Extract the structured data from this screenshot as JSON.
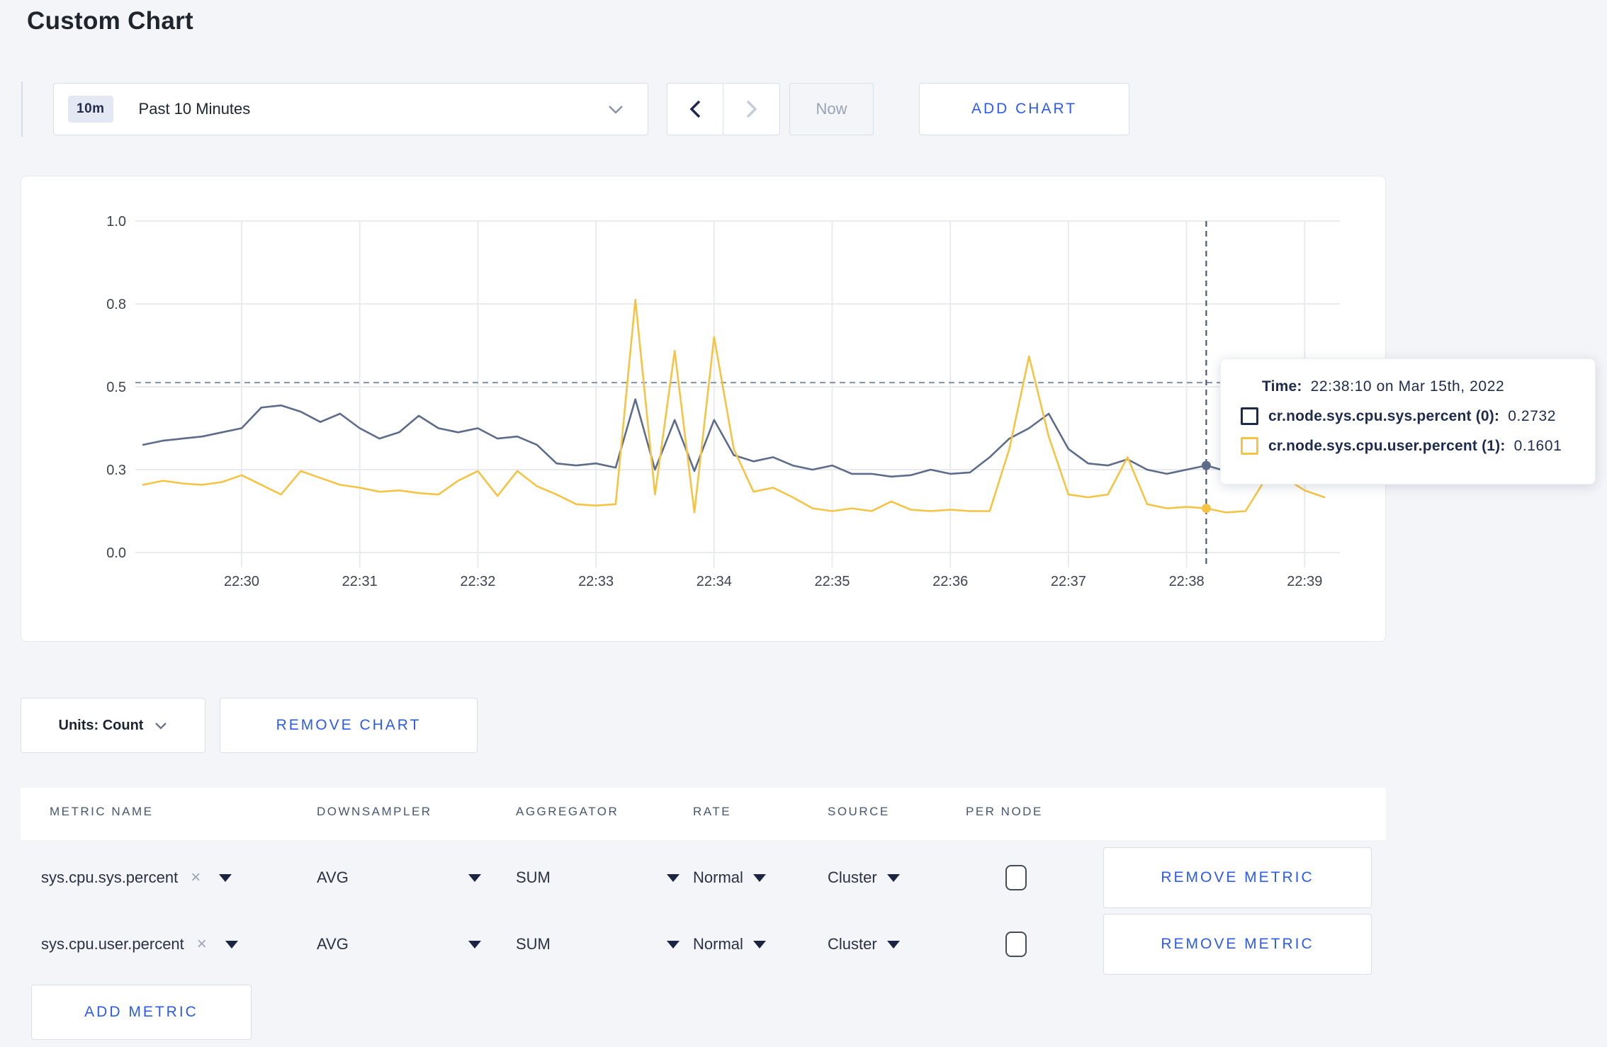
{
  "page": {
    "title": "Custom Chart"
  },
  "toolbar": {
    "range_badge": "10m",
    "range_label": "Past 10 Minutes",
    "now_label": "Now",
    "add_chart_label": "ADD CHART"
  },
  "chart_data": {
    "type": "line",
    "title": "",
    "xlabel": "",
    "ylabel": "",
    "y_ticks": [
      0.0,
      0.3,
      0.5,
      0.8,
      1.0
    ],
    "y_tick_labels": [
      "0.0",
      "0.3",
      "0.5",
      "0.8",
      "1.0"
    ],
    "y_scale_note": "ticks rendered equally spaced",
    "x_ticks": [
      "22:30",
      "22:31",
      "22:32",
      "22:33",
      "22:34",
      "22:35",
      "22:36",
      "22:37",
      "22:38",
      "22:39"
    ],
    "x_start_offset_sec": -50,
    "interval_sec": 10,
    "grid": true,
    "legend_position": "tooltip",
    "series": [
      {
        "name": "cr.node.sys.cpu.sys.percent (0)",
        "color": "#5d6c8b",
        "values": [
          0.36,
          0.37,
          0.375,
          0.38,
          0.39,
          0.4,
          0.45,
          0.455,
          0.44,
          0.415,
          0.435,
          0.4,
          0.375,
          0.39,
          0.43,
          0.4,
          0.39,
          0.4,
          0.375,
          0.38,
          0.36,
          0.315,
          0.31,
          0.315,
          0.305,
          0.47,
          0.3,
          0.42,
          0.295,
          0.42,
          0.335,
          0.32,
          0.33,
          0.31,
          0.3,
          0.31,
          0.285,
          0.285,
          0.275,
          0.28,
          0.3,
          0.285,
          0.29,
          0.33,
          0.375,
          0.4,
          0.435,
          0.35,
          0.315,
          0.31,
          0.325,
          0.3,
          0.285,
          0.3,
          0.31,
          0.295,
          0.3,
          0.31,
          0.3,
          0.305,
          0.3
        ]
      },
      {
        "name": "cr.node.sys.cpu.user.percent (1)",
        "color": "#f6c444",
        "values": [
          0.245,
          0.26,
          0.25,
          0.245,
          0.255,
          0.28,
          0.245,
          0.21,
          0.295,
          0.27,
          0.245,
          0.235,
          0.22,
          0.225,
          0.215,
          0.21,
          0.26,
          0.295,
          0.205,
          0.295,
          0.24,
          0.21,
          0.175,
          0.17,
          0.175,
          0.81,
          0.21,
          0.63,
          0.145,
          0.68,
          0.35,
          0.22,
          0.235,
          0.2,
          0.16,
          0.15,
          0.16,
          0.15,
          0.185,
          0.155,
          0.15,
          0.155,
          0.15,
          0.15,
          0.35,
          0.61,
          0.38,
          0.21,
          0.2,
          0.21,
          0.33,
          0.175,
          0.16,
          0.165,
          0.16,
          0.145,
          0.15,
          0.265,
          0.27,
          0.225,
          0.2
        ]
      }
    ],
    "crosshair": {
      "x_offset_sec": 490,
      "y_value": 0.515,
      "points": [
        {
          "series": 0,
          "value": 0.31
        },
        {
          "series": 1,
          "value": 0.16
        }
      ]
    },
    "colors": {
      "grid": "#e9ebee",
      "crosshair_h": "#7e93ab",
      "crosshair_v": "#4a5a74",
      "axis_text": "#3d4350"
    }
  },
  "tooltip": {
    "time_label": "Time:",
    "time_value": "22:38:10 on Mar 15th, 2022",
    "series": [
      {
        "label": "cr.node.sys.cpu.sys.percent (0):",
        "value": "0.2732",
        "color": "#1f2a48"
      },
      {
        "label": "cr.node.sys.cpu.user.percent (1):",
        "value": "0.1601",
        "color": "#f5c542"
      }
    ]
  },
  "units": {
    "label": "Units: Count"
  },
  "remove_chart_label": "REMOVE CHART",
  "table": {
    "headers": [
      "METRIC NAME",
      "DOWNSAMPLER",
      "AGGREGATOR",
      "RATE",
      "SOURCE",
      "PER NODE"
    ],
    "rows": [
      {
        "metric": "sys.cpu.sys.percent",
        "close": "×",
        "downsampler": "AVG",
        "aggregator": "SUM",
        "rate": "Normal",
        "source": "Cluster",
        "per_node_checked": false,
        "remove_label": "REMOVE METRIC"
      },
      {
        "metric": "sys.cpu.user.percent",
        "close": "×",
        "downsampler": "AVG",
        "aggregator": "SUM",
        "rate": "Normal",
        "source": "Cluster",
        "per_node_checked": false,
        "remove_label": "REMOVE METRIC"
      }
    ],
    "add_metric_label": "ADD METRIC"
  }
}
